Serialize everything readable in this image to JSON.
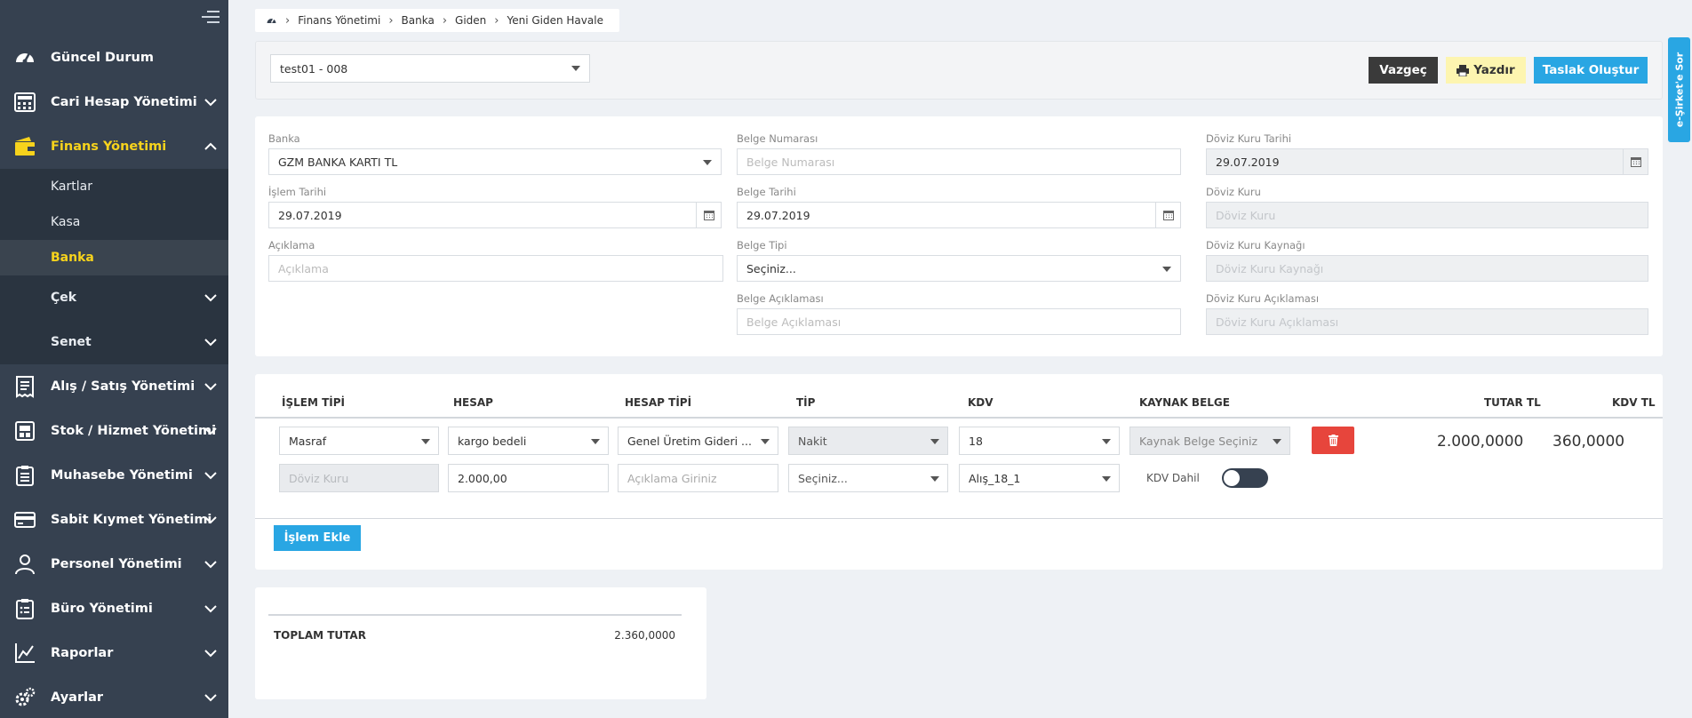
{
  "sidebar": {
    "items": [
      {
        "label": "Güncel Durum",
        "icon": "dashboard-icon"
      },
      {
        "label": "Cari Hesap Yönetimi",
        "icon": "calculator-icon"
      },
      {
        "label": "Finans Yönetimi",
        "icon": "wallet-icon"
      },
      {
        "label": "Alış / Satış Yönetimi",
        "icon": "receipt-icon"
      },
      {
        "label": "Stok / Hizmet Yönetimi",
        "icon": "box-icon"
      },
      {
        "label": "Muhasebe Yönetimi",
        "icon": "clipboard-icon"
      },
      {
        "label": "Sabit Kıymet Yönetimi",
        "icon": "credit-card-icon"
      },
      {
        "label": "Personel Yönetimi",
        "icon": "user-icon"
      },
      {
        "label": "Büro Yönetimi",
        "icon": "clipboard-list-icon"
      },
      {
        "label": "Raporlar",
        "icon": "chart-icon"
      },
      {
        "label": "Ayarlar",
        "icon": "gears-icon"
      }
    ],
    "finans_sub": [
      "Kartlar",
      "Kasa",
      "Banka",
      "Çek",
      "Senet"
    ]
  },
  "breadcrumb": {
    "items": [
      "Finans Yönetimi",
      "Banka",
      "Giden",
      "Yeni Giden Havale"
    ]
  },
  "top": {
    "select_value": "test01 - 008",
    "cancel": "Vazgeç",
    "print": "Yazdır",
    "draft": "Taslak Oluştur"
  },
  "form": {
    "banka": {
      "label": "Banka",
      "value": "GZM BANKA KARTI TL"
    },
    "islem_tarihi": {
      "label": "İşlem Tarihi",
      "value": "29.07.2019"
    },
    "aciklama": {
      "label": "Açıklama",
      "placeholder": "Açıklama"
    },
    "belge_numarasi": {
      "label": "Belge Numarası",
      "placeholder": "Belge Numarası"
    },
    "belge_tarihi": {
      "label": "Belge Tarihi",
      "value": "29.07.2019"
    },
    "belge_tipi": {
      "label": "Belge Tipi",
      "value": "Seçiniz..."
    },
    "belge_aciklamasi": {
      "label": "Belge Açıklaması",
      "placeholder": "Belge Açıklaması"
    },
    "doviz_kuru_tarihi": {
      "label": "Döviz Kuru Tarihi",
      "value": "29.07.2019"
    },
    "doviz_kuru": {
      "label": "Döviz Kuru",
      "placeholder": "Döviz Kuru"
    },
    "doviz_kuru_kaynagi": {
      "label": "Döviz Kuru Kaynağı",
      "placeholder": "Döviz Kuru Kaynağı"
    },
    "doviz_kuru_aciklamasi": {
      "label": "Döviz Kuru Açıklaması",
      "placeholder": "Döviz Kuru Açıklaması"
    }
  },
  "table": {
    "headers": [
      "İŞLEM TİPİ",
      "HESAP",
      "HESAP TİPİ",
      "TİP",
      "KDV",
      "KAYNAK BELGE",
      "TUTAR TL",
      "KDV TL"
    ],
    "row": {
      "islem_tipi": "Masraf",
      "hesap": "kargo bedeli",
      "hesap_tipi": "Genel Üretim Gideri ...",
      "tip": "Nakit",
      "kdv": "18",
      "kaynak_belge": "Kaynak Belge Seçiniz",
      "tutar": "2.000,0000",
      "kdv_tl": "360,0000",
      "doviz_kuru_placeholder": "Döviz Kuru",
      "amount": "2.000,00",
      "aciklama_placeholder": "Açıklama Giriniz",
      "secim": "Seçiniz...",
      "kdv_kodu": "Alış_18_1",
      "kdv_dahil_label": "KDV Dahil",
      "kdv_dahil_on": false
    },
    "add_button": "İşlem Ekle"
  },
  "total": {
    "label": "TOPLAM TUTAR",
    "value": "2.360,0000"
  },
  "help_tab": "e-Şirket'e Sor",
  "colors": {
    "sidebar": "#364150",
    "accent": "#f7d31c",
    "primary": "#29a6e3",
    "danger": "#e7453c",
    "dark_button": "#3a3a3a",
    "print_button": "#fdf5b0"
  }
}
